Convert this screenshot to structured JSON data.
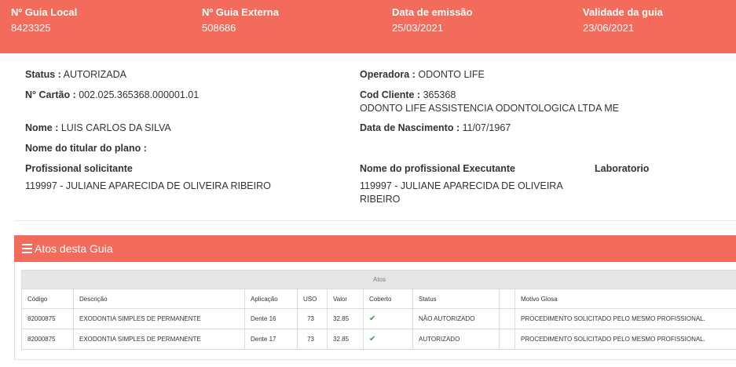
{
  "header": {
    "guia_local_label": "Nº Guia Local",
    "guia_local_value": "8423325",
    "guia_externa_label": "Nº Guia Externa",
    "guia_externa_value": "508686",
    "emissao_label": "Data de emissão",
    "emissao_value": "25/03/2021",
    "validade_label": "Validade da guia",
    "validade_value": "23/06/2021"
  },
  "details": {
    "status_label": "Status :",
    "status_value": "AUTORIZADA",
    "operadora_label": "Operadora :",
    "operadora_value": "ODONTO LIFE",
    "cartao_label": "N° Cartão :",
    "cartao_value": "002.025.365368.000001.01",
    "cod_cliente_label": "Cod Cliente :",
    "cod_cliente_value": "365368",
    "cod_cliente_name": "ODONTO LIFE ASSISTENCIA ODONTOLOGICA LTDA ME",
    "nome_label": "Nome :",
    "nome_value": "LUIS CARLOS DA SILVA",
    "nascimento_label": "Data de Nascimento :",
    "nascimento_value": "11/07/1967",
    "titular_label": "Nome do titular do plano :",
    "solicitante_label": "Profissional solicitante",
    "solicitante_value": "119997 - JULIANE APARECIDA DE OLIVEIRA RIBEIRO",
    "executante_label": "Nome do profissional Executante",
    "executante_value_line1": "119997 - JULIANE APARECIDA DE OLIVEIRA",
    "executante_value_line2": "RIBEIRO",
    "laboratorio_label": "Laboratorio"
  },
  "panel": {
    "title": "Atos desta Guia",
    "table_group_label": "Atos",
    "columns": [
      "Código",
      "Descrição",
      "Aplicação",
      "USO",
      "Valor",
      "Coberto",
      "Status",
      "",
      "Motivo Glosa"
    ],
    "rows": [
      [
        "82000875",
        "EXODONTIA SIMPLES DE PERMANENTE",
        "Dente 16",
        "73",
        "32.85",
        "✔",
        "NÃO AUTORIZADO",
        "",
        "PROCEDIMENTO SOLICITADO PELO MESMO PROFISSIONAL."
      ],
      [
        "82000875",
        "EXODONTIA SIMPLES DE PERMANENTE",
        "Dente 17",
        "73",
        "32.85",
        "✔",
        "AUTORIZADO",
        "",
        "PROCEDIMENTO SOLICITADO PELO MESMO PROFISSIONAL."
      ]
    ]
  },
  "colors": {
    "accent": "#f26b5b",
    "check": "#2e9d3c"
  }
}
